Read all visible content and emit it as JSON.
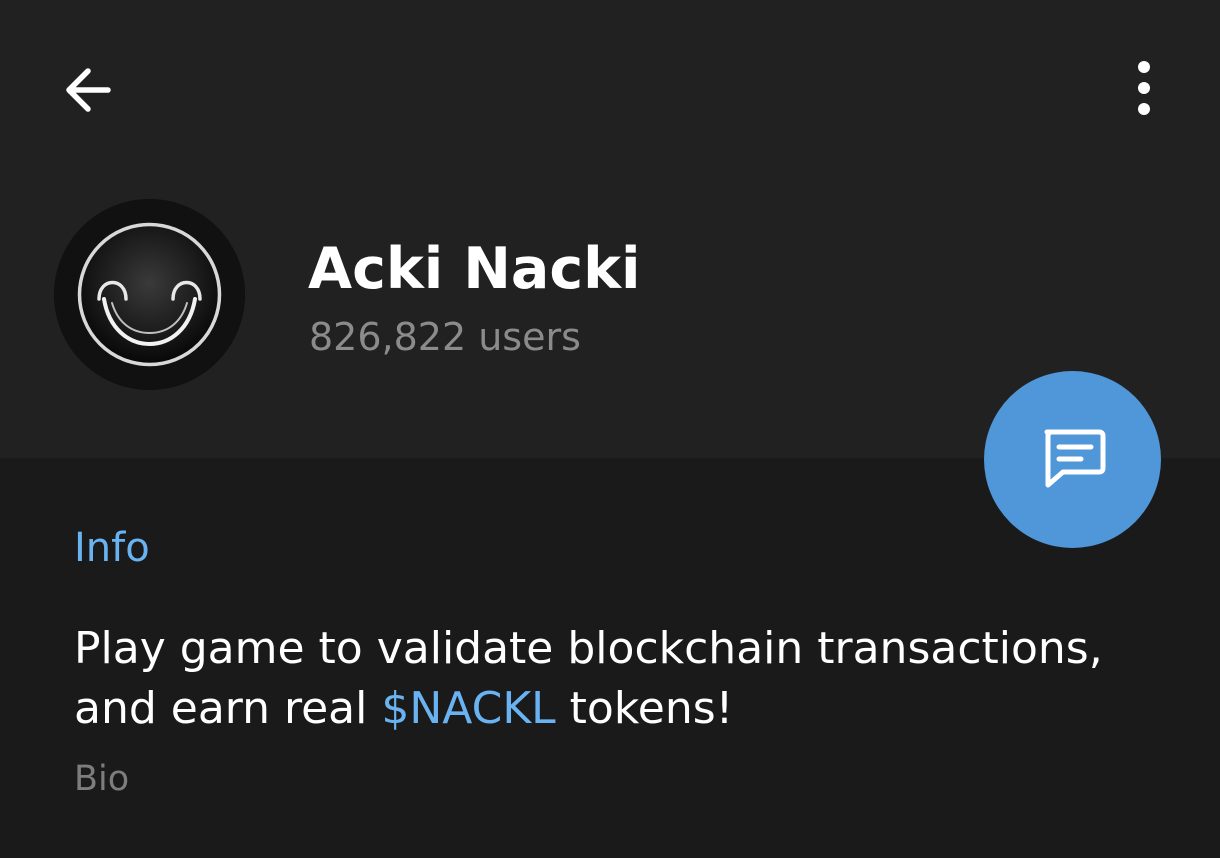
{
  "header": {
    "back_icon": "arrow-left-icon",
    "menu_icon": "more-vertical-icon",
    "title": "Acki Nacki",
    "subtitle": "826,822 users",
    "avatar_icon": "smiling-face-logo"
  },
  "fab": {
    "icon": "message-icon",
    "color": "#4f97d8"
  },
  "info": {
    "section_label": "Info",
    "bio_text_part1": "Play game to validate blockchain transactions, and earn real ",
    "bio_link": "$NACKL",
    "bio_text_part2": " tokens!",
    "bio_caption": "Bio"
  },
  "colors": {
    "background": "#1a1a1a",
    "header_background": "#212121",
    "accent": "#6ab3f3",
    "secondary_text": "#8b8b8b"
  }
}
